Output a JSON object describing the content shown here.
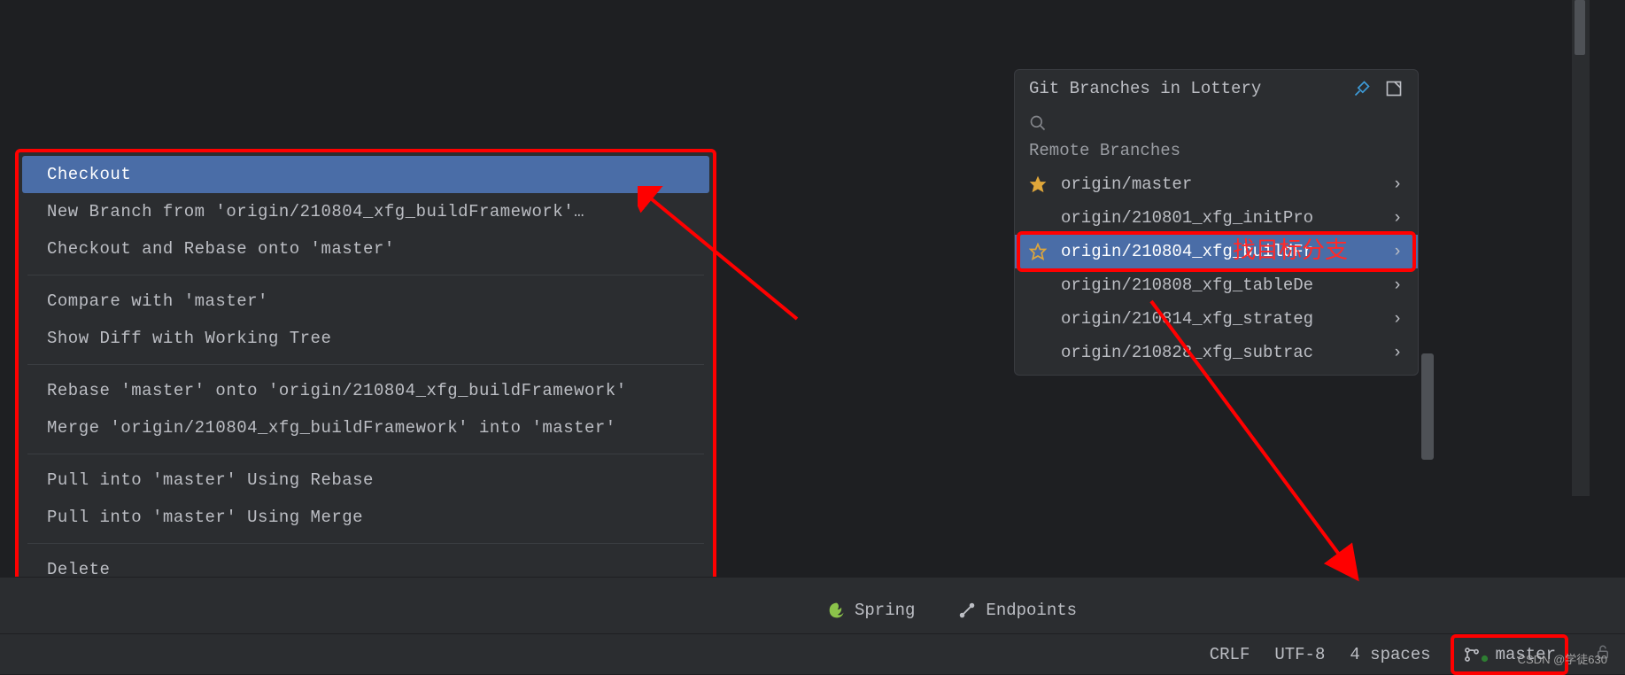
{
  "contextMenu": {
    "checkout": "Checkout",
    "newBranch": "New Branch from 'origin/210804_xfg_buildFramework'…",
    "checkoutRebase": "Checkout and Rebase onto 'master'",
    "compare": "Compare with 'master'",
    "showDiff": "Show Diff with Working Tree",
    "rebase": "Rebase 'master' onto 'origin/210804_xfg_buildFramework'",
    "merge": "Merge 'origin/210804_xfg_buildFramework' into 'master'",
    "pullRebase": "Pull into 'master' Using Rebase",
    "pullMerge": "Pull into 'master' Using Merge",
    "delete": "Delete"
  },
  "branchesPopup": {
    "title": "Git Branches in Lottery",
    "section": "Remote Branches",
    "items": [
      {
        "name": "origin/master",
        "starred": true,
        "selected": false
      },
      {
        "name": "origin/210801_xfg_initPro",
        "starred": false,
        "selected": false
      },
      {
        "name": "origin/210804_xfg_buildFr",
        "starred": false,
        "selected": true
      },
      {
        "name": "origin/210808_xfg_tableDe",
        "starred": false,
        "selected": false
      },
      {
        "name": "origin/210814_xfg_strateg",
        "starred": false,
        "selected": false
      },
      {
        "name": "origin/210828_xfg_subtrac",
        "starred": false,
        "selected": false
      }
    ]
  },
  "statusBar": {
    "lineSep": "CRLF",
    "encoding": "UTF-8",
    "indent": "4 spaces",
    "branch": "master"
  },
  "toolWindows": {
    "spring": "Spring",
    "endpoints": "Endpoints"
  },
  "annotation": {
    "findTarget": "找目标分支"
  },
  "watermark": "CSDN @学徒630"
}
